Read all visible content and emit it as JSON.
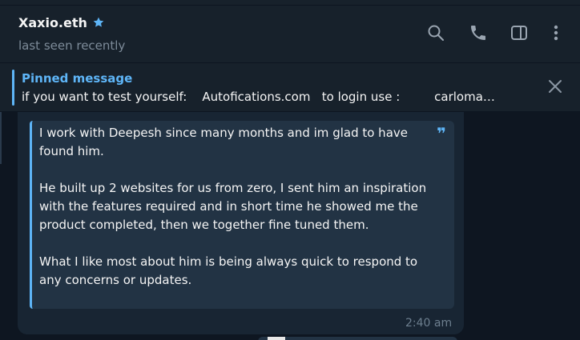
{
  "header": {
    "contact_name": "Xaxio.eth",
    "status": "last seen recently",
    "icons": {
      "verified": "star-icon",
      "search": "search-icon",
      "call": "phone-icon",
      "sidebar": "sidebar-toggle-icon",
      "more": "more-vertical-icon"
    }
  },
  "pinned": {
    "title": "Pinned message",
    "text": "if you want to test yourself:    Autofications.com   to login use :         carloma…",
    "close_icon": "close-icon"
  },
  "message": {
    "quote_paragraphs": [
      "I work with Deepesh since many months and im glad to have found him.",
      "He built up 2 websites for us from zero, I sent him an inspiration with the features required and in short time he showed me the product completed, then we together fine tuned them.",
      "What I like most about him is being always quick to respond to any concerns or updates."
    ],
    "quote_mark": "❞",
    "time": "2:40 am"
  },
  "colors": {
    "background": "#0e1621",
    "panel": "#17212b",
    "accent": "#5eb5f7",
    "bubble": "#182533",
    "quote_bg": "#223344"
  }
}
